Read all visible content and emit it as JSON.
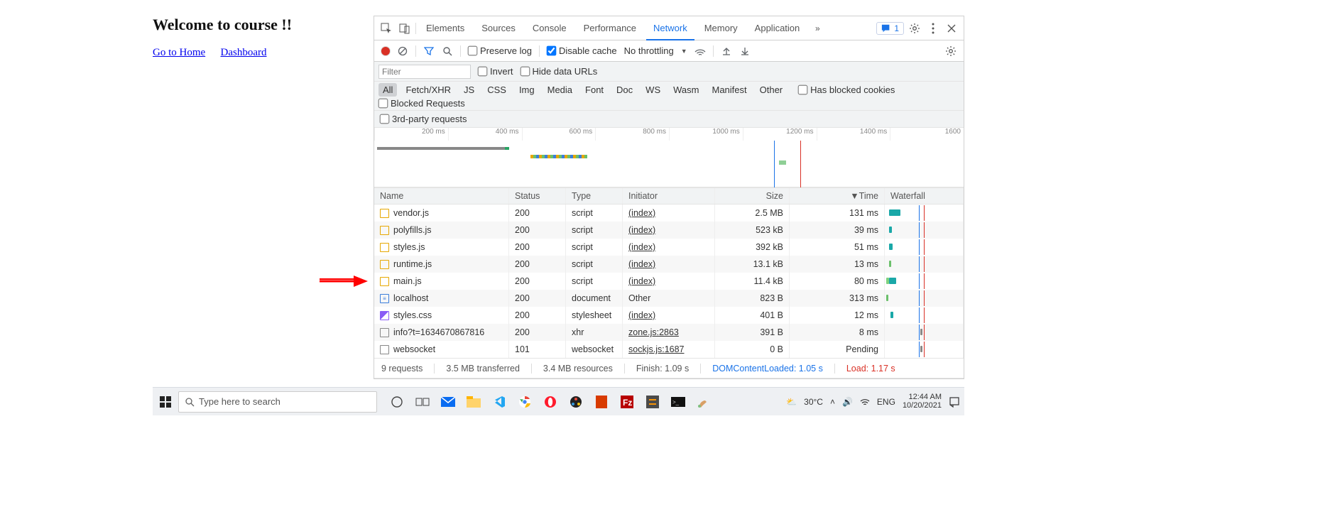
{
  "page": {
    "title": "Welcome to course !!",
    "links": [
      {
        "label": "Go to Home"
      },
      {
        "label": "Dashboard"
      }
    ]
  },
  "devtools": {
    "tabs": [
      "Elements",
      "Sources",
      "Console",
      "Performance",
      "Network",
      "Memory",
      "Application"
    ],
    "active_tab": "Network",
    "issues_count": "1",
    "toolbar": {
      "preserve_log": "Preserve log",
      "preserve_log_checked": false,
      "disable_cache": "Disable cache",
      "disable_cache_checked": true,
      "throttling": "No throttling"
    },
    "filter": {
      "placeholder": "Filter",
      "invert": "Invert",
      "hide_data_urls": "Hide data URLs"
    },
    "types": [
      "All",
      "Fetch/XHR",
      "JS",
      "CSS",
      "Img",
      "Media",
      "Font",
      "Doc",
      "WS",
      "Wasm",
      "Manifest",
      "Other"
    ],
    "has_blocked_cookies": "Has blocked cookies",
    "blocked_requests": "Blocked Requests",
    "third_party": "3rd-party requests",
    "timeline_ticks": [
      "200 ms",
      "400 ms",
      "600 ms",
      "800 ms",
      "1000 ms",
      "1200 ms",
      "1400 ms",
      "1600"
    ],
    "columns": {
      "name": "Name",
      "status": "Status",
      "type": "Type",
      "initiator": "Initiator",
      "size": "Size",
      "time": "Time",
      "waterfall": "Waterfall"
    },
    "rows": [
      {
        "icon": "js",
        "name": "vendor.js",
        "status": "200",
        "type": "script",
        "initiator": "(index)",
        "size": "2.5 MB",
        "time": "131 ms"
      },
      {
        "icon": "js",
        "name": "polyfills.js",
        "status": "200",
        "type": "script",
        "initiator": "(index)",
        "size": "523 kB",
        "time": "39 ms"
      },
      {
        "icon": "js",
        "name": "styles.js",
        "status": "200",
        "type": "script",
        "initiator": "(index)",
        "size": "392 kB",
        "time": "51 ms"
      },
      {
        "icon": "js",
        "name": "runtime.js",
        "status": "200",
        "type": "script",
        "initiator": "(index)",
        "size": "13.1 kB",
        "time": "13 ms"
      },
      {
        "icon": "js",
        "name": "main.js",
        "status": "200",
        "type": "script",
        "initiator": "(index)",
        "size": "11.4 kB",
        "time": "80 ms"
      },
      {
        "icon": "doc",
        "name": "localhost",
        "status": "200",
        "type": "document",
        "initiator": "Other",
        "size": "823 B",
        "time": "313 ms"
      },
      {
        "icon": "css",
        "name": "styles.css",
        "status": "200",
        "type": "stylesheet",
        "initiator": "(index)",
        "size": "401 B",
        "time": "12 ms"
      },
      {
        "icon": "oth",
        "name": "info?t=1634670867816",
        "status": "200",
        "type": "xhr",
        "initiator": "zone.js:2863",
        "size": "391 B",
        "time": "8 ms"
      },
      {
        "icon": "oth",
        "name": "websocket",
        "status": "101",
        "type": "websocket",
        "initiator": "sockjs.js:1687",
        "size": "0 B",
        "time": "Pending"
      }
    ],
    "summary": {
      "requests": "9 requests",
      "transferred": "3.5 MB transferred",
      "resources": "3.4 MB resources",
      "finish": "Finish: 1.09 s",
      "dcl": "DOMContentLoaded: 1.05 s",
      "load": "Load: 1.17 s"
    }
  },
  "taskbar": {
    "search_placeholder": "Type here to search",
    "weather": "30°C",
    "lang": "ENG",
    "time": "12:44 AM",
    "date": "10/20/2021"
  }
}
